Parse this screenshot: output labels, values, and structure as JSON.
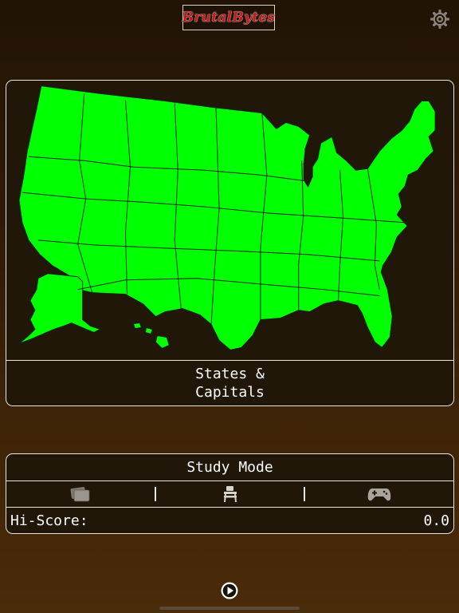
{
  "header": {
    "logo_text": "BrutalBytes",
    "settings_icon": "gear-icon"
  },
  "map_card": {
    "map_fill_color": "#00ff00",
    "map_border_color": "#0a2a0a",
    "caption_line1": "States &",
    "caption_line2": "Capitals"
  },
  "panel": {
    "title": "Study Mode",
    "modes": [
      {
        "icon": "flashcards-icon"
      },
      {
        "icon": "school-desk-icon"
      },
      {
        "icon": "gamepad-icon"
      }
    ],
    "hiscore_label": "Hi-Score:",
    "hiscore_value": "0.0"
  },
  "footer": {
    "play_icon": "play-circle-icon"
  },
  "colors": {
    "background_top": "#211405",
    "background_bottom": "#4a2b0a",
    "card_border": "#e8e4de",
    "logo_red": "#c01a1a"
  }
}
